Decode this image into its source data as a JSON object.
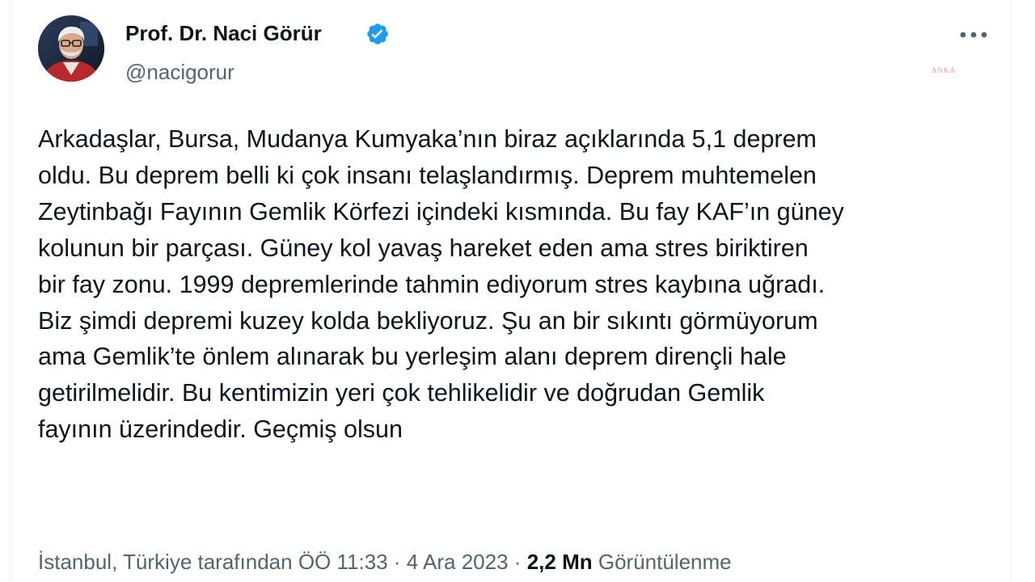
{
  "header_fragment": "• ••••• ••• •••",
  "author": {
    "name": "Prof. Dr. Naci Görür",
    "handle": "@nacigorur",
    "verified": true,
    "badge_color": "#1d9bf0"
  },
  "more_button_label": "•••",
  "watermark": "ANKA",
  "tweet": {
    "lines": [
      "Arkadaşlar, Bursa, Mudanya Kumyaka’nın biraz açıklarında 5,1 deprem",
      "oldu. Bu deprem belli ki çok insanı telaşlandırmış. Deprem muhtemelen",
      "Zeytinbağı Fayının Gemlik Körfezi içindeki kısmında. Bu fay KAF’ın güney",
      "kolunun bir parçası. Güney kol yavaş hareket eden ama stres biriktiren",
      "bir fay zonu. 1999 depremlerinde tahmin ediyorum stres kaybına uğradı.",
      "Biz şimdi depremi kuzey kolda bekliyoruz. Şu an bir sıkıntı görmüyorum",
      "ama Gemlik’te önlem alınarak bu yerleşim alanı deprem dirençli hale",
      "getirilmelidir.  Bu kentimizin yeri çok tehlikelidir ve doğrudan Gemlik",
      "fayının üzerindedir. Geçmiş olsun"
    ]
  },
  "meta": {
    "location": "İstanbul, Türkiye tarafından",
    "time": "ÖÖ 11:33",
    "date": "4 Ara 2023",
    "separator": "·",
    "views_count": "2,2 Mn",
    "views_label": "Görüntülenme"
  },
  "colors": {
    "text_primary": "#0f1419",
    "text_secondary": "#536471",
    "accent": "#1d9bf0"
  }
}
